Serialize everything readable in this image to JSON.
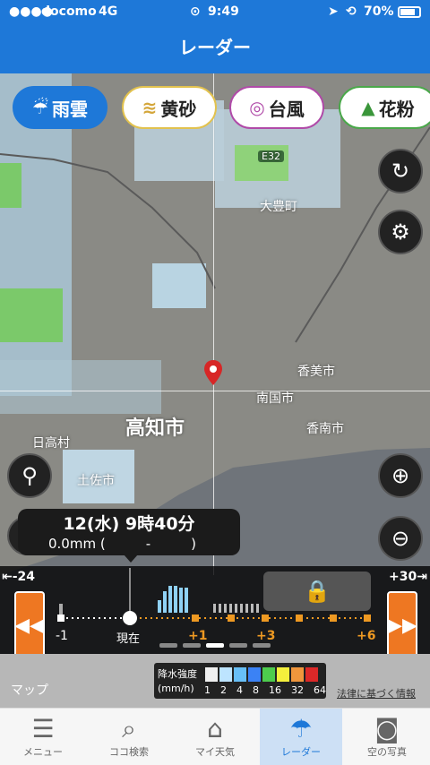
{
  "status_bar": {
    "carrier": "docomo",
    "network": "4G",
    "time": "9:49",
    "battery": "70%"
  },
  "header": {
    "title": "レーダー"
  },
  "categories": [
    {
      "label": "雨雲",
      "icon": "rain-cloud-icon",
      "active": true
    },
    {
      "label": "黄砂",
      "icon": "dust-icon",
      "active": false
    },
    {
      "label": "台風",
      "icon": "typhoon-icon",
      "active": false
    },
    {
      "label": "花粉",
      "icon": "pollen-tree-icon",
      "active": false
    }
  ],
  "map": {
    "places": [
      "大豊町",
      "香美市",
      "南国市",
      "香南市",
      "高知市",
      "日高村",
      "土佐市"
    ],
    "highway": "E32",
    "attribution": "マップ",
    "legal_link": "法律に基づく情報"
  },
  "time_popup": {
    "datetime": "12(水) 9時40分",
    "precip": "0.0mm (　　　-　　　)"
  },
  "timeline": {
    "left_label": "-24",
    "right_label": "+30",
    "ticks": [
      "-1",
      "現在",
      "+1",
      "+3",
      "+6"
    ]
  },
  "legend": {
    "title_line1": "降水強度",
    "title_line2": "(mm/h)",
    "values": [
      "1",
      "2",
      "4",
      "8",
      "16",
      "32",
      "64"
    ],
    "colors": [
      "#f0f0f0",
      "#bde4ff",
      "#68bff7",
      "#3b82f5",
      "#4dcc4d",
      "#f5f03c",
      "#f0963c",
      "#dc2828"
    ]
  },
  "tabs": [
    {
      "label": "メニュー",
      "icon": "menu-icon",
      "active": false
    },
    {
      "label": "ココ検索",
      "icon": "search-icon",
      "active": false
    },
    {
      "label": "マイ天気",
      "icon": "home-icon",
      "active": false
    },
    {
      "label": "レーダー",
      "icon": "umbrella-icon",
      "active": true
    },
    {
      "label": "空の写真",
      "icon": "camera-icon",
      "active": false
    }
  ]
}
